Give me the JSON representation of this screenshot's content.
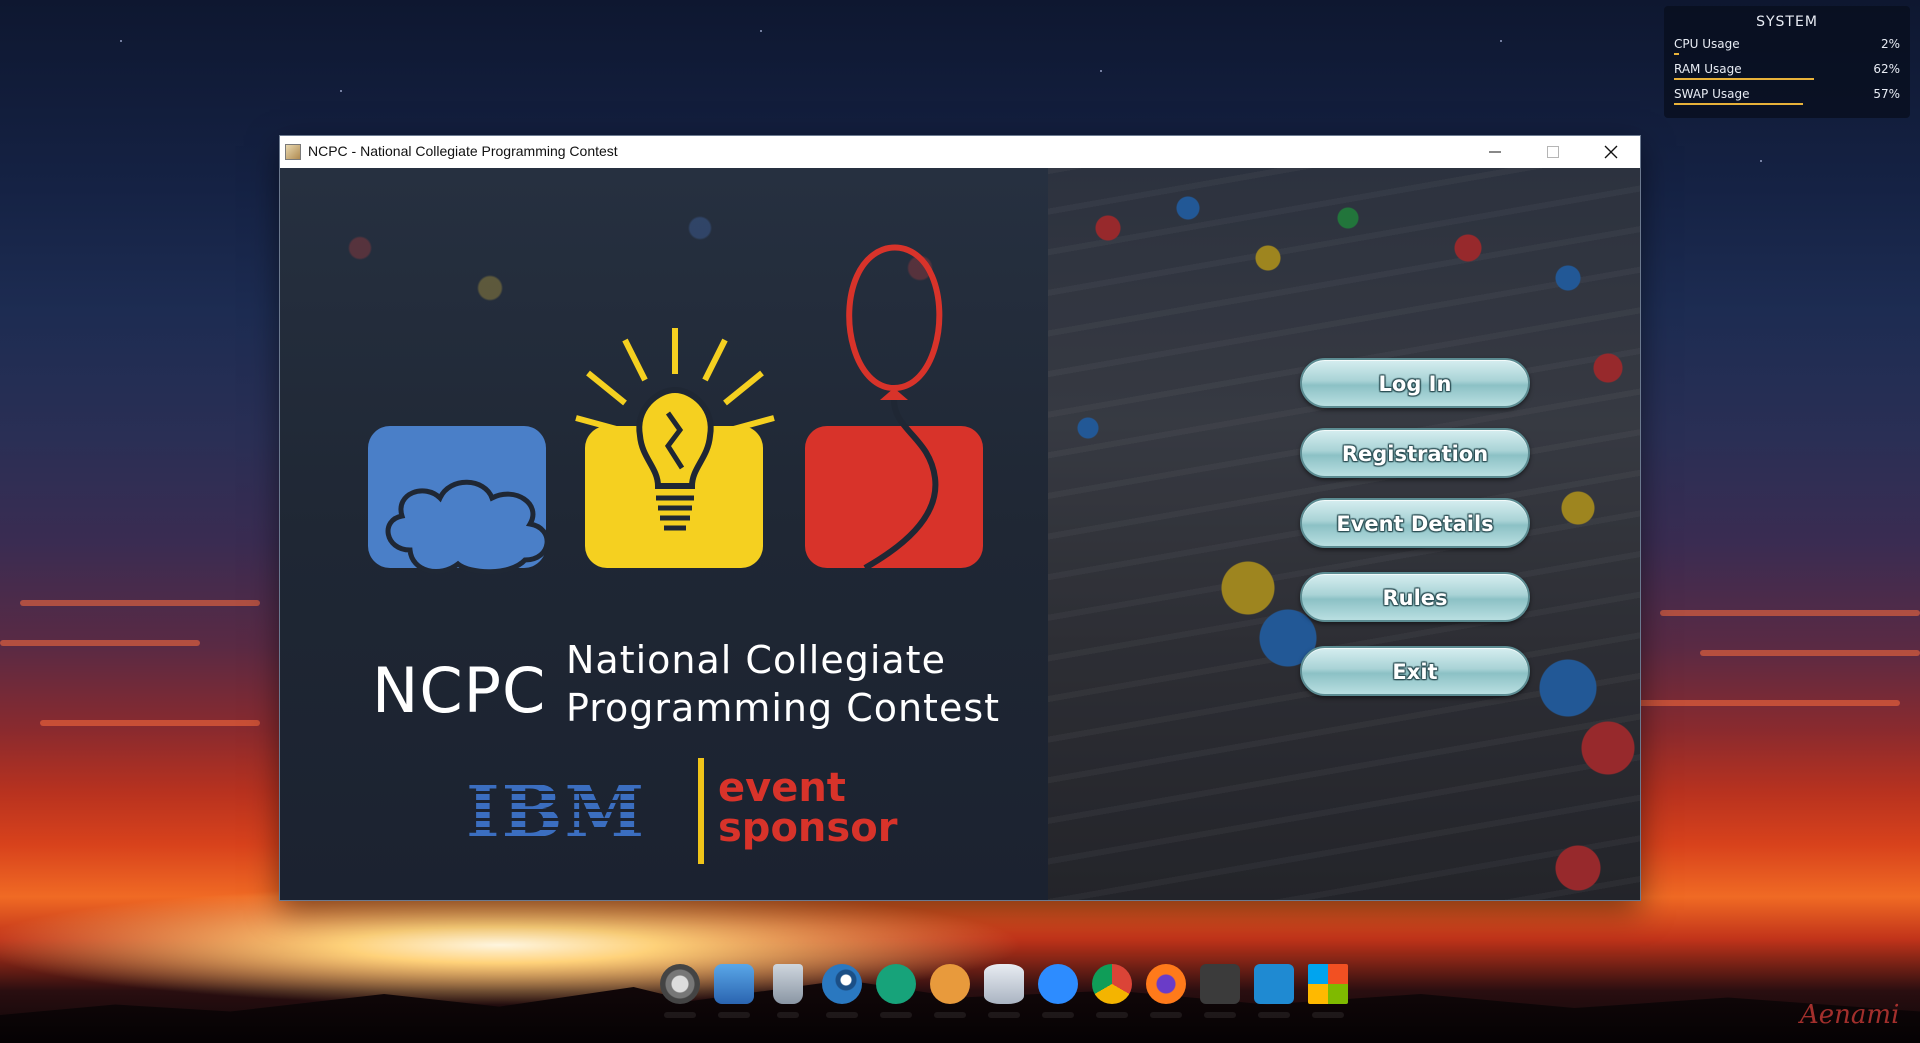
{
  "desktop": {
    "signature": "Aenami"
  },
  "system_widget": {
    "title": "SYSTEM",
    "metrics": [
      {
        "label": "CPU Usage",
        "value": "2%",
        "fraction": 0.02
      },
      {
        "label": "RAM Usage",
        "value": "62%",
        "fraction": 0.62
      },
      {
        "label": "SWAP Usage",
        "value": "57%",
        "fraction": 0.57
      }
    ],
    "accent": "#e8b23a"
  },
  "window": {
    "title": "NCPC - National Collegiate Programming Contest",
    "controls": [
      "minimize",
      "maximize",
      "close"
    ]
  },
  "branding": {
    "abbr": "NCPC",
    "name_line1": "National Collegiate",
    "name_line2": "Programming Contest",
    "sponsor_logo": "IBM",
    "sponsor_line1": "event",
    "sponsor_line2": "sponsor",
    "colors": {
      "blue": "#4a7fc8",
      "yellow": "#f5d020",
      "red": "#d8332a"
    },
    "icons": [
      "thought-cloud-icon",
      "lightbulb-icon",
      "balloon-icon"
    ]
  },
  "menu": {
    "buttons": [
      {
        "id": "login",
        "label": "Log In"
      },
      {
        "id": "registration",
        "label": "Registration"
      },
      {
        "id": "event_details",
        "label": "Event Details"
      },
      {
        "id": "rules",
        "label": "Rules"
      },
      {
        "id": "exit",
        "label": "Exit"
      }
    ],
    "button_color": "#a9d3d6"
  },
  "dock": {
    "items": [
      "settings-icon",
      "file-manager-icon",
      "trash-icon",
      "steam-icon",
      "document-viewer-icon",
      "downloader-icon",
      "database-icon",
      "zoom-icon",
      "chrome-icon",
      "firefox-icon",
      "sublime-text-icon",
      "vscode-icon",
      "windows-store-icon"
    ]
  }
}
